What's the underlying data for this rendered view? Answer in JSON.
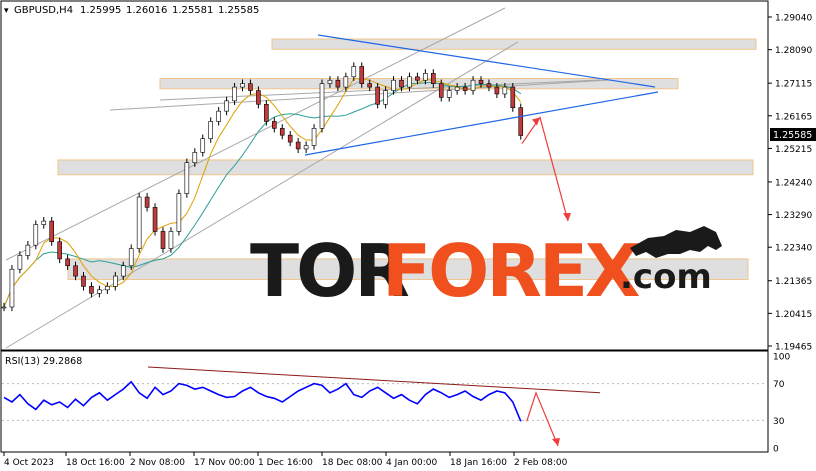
{
  "chart_data": {
    "type": "candlestick",
    "header": {
      "symbol": "GBPUSD,H4",
      "open": "1.25995",
      "high": "1.26016",
      "low": "1.25581",
      "close": "1.25585"
    },
    "price_axis": {
      "range": [
        1.19,
        1.299
      ],
      "ticks": [
        "1.29040",
        "1.28090",
        "1.27115",
        "1.26165",
        "1.25215",
        "1.24240",
        "1.23290",
        "1.22340",
        "1.21365",
        "1.20415",
        "1.19465"
      ],
      "current_price": "1.25585"
    },
    "time_axis": {
      "ticks": [
        "4 Oct 2023",
        "18 Oct 16:00",
        "2 Nov 08:00",
        "17 Nov 00:00",
        "1 Dec 16:00",
        "18 Dec 08:00",
        "4 Jan 00:00",
        "18 Jan 16:00",
        "2 Feb 08:00"
      ]
    },
    "price_series": {
      "x": [
        0,
        8,
        16,
        24,
        32,
        40,
        48,
        56,
        64,
        72,
        80,
        88,
        96,
        104,
        112,
        120,
        128,
        136,
        144,
        152,
        160,
        168,
        176,
        184,
        192,
        200,
        208,
        216,
        224,
        232,
        240,
        248,
        256,
        264,
        272,
        280,
        288,
        296,
        304,
        312,
        320,
        328,
        336,
        344,
        352,
        360,
        368,
        376,
        384,
        392,
        400,
        408,
        416,
        424,
        432,
        440,
        448,
        456,
        464,
        472,
        480,
        488,
        496,
        504,
        512,
        520
      ],
      "close": [
        1.206,
        1.217,
        1.221,
        1.224,
        1.23,
        1.231,
        1.225,
        1.22,
        1.218,
        1.215,
        1.212,
        1.21,
        1.211,
        1.212,
        1.215,
        1.218,
        1.223,
        1.238,
        1.235,
        1.228,
        1.223,
        1.228,
        1.239,
        1.248,
        1.251,
        1.255,
        1.26,
        1.263,
        1.266,
        1.27,
        1.271,
        1.269,
        1.265,
        1.26,
        1.258,
        1.256,
        1.254,
        1.252,
        1.253,
        1.258,
        1.271,
        1.272,
        1.27,
        1.273,
        1.276,
        1.271,
        1.27,
        1.265,
        1.269,
        1.272,
        1.27,
        1.273,
        1.272,
        1.274,
        1.271,
        1.267,
        1.269,
        1.27,
        1.269,
        1.272,
        1.271,
        1.27,
        1.268,
        1.27,
        1.264,
        1.2559
      ]
    },
    "horizontal_zones": [
      {
        "top": 1.284,
        "bottom": 1.281
      },
      {
        "top": 1.2725,
        "bottom": 1.2695
      },
      {
        "top": 1.2488,
        "bottom": 1.2445
      },
      {
        "top": 1.22,
        "bottom": 1.214
      }
    ],
    "forecast_arrows_price": [
      1.2559,
      1.26,
      1.231
    ],
    "rsi": {
      "label": "RSI(13) 29.2868",
      "levels": [
        "100",
        "70",
        "30",
        "0"
      ],
      "values": [
        55,
        50,
        58,
        48,
        42,
        52,
        47,
        50,
        44,
        53,
        46,
        55,
        60,
        52,
        58,
        64,
        72,
        60,
        54,
        66,
        58,
        62,
        70,
        68,
        64,
        66,
        62,
        58,
        55,
        56,
        62,
        66,
        60,
        56,
        54,
        50,
        56,
        62,
        66,
        70,
        68,
        60,
        64,
        70,
        58,
        55,
        62,
        66,
        60,
        54,
        58,
        52,
        48,
        58,
        64,
        60,
        55,
        58,
        62,
        56,
        52,
        58,
        62,
        60,
        50,
        29
      ]
    }
  },
  "watermark": {
    "text_a": "TOR",
    "text_b": "FOREX",
    "text_c": ".com",
    "color_a": "#1a1a1a",
    "color_b": "#f0501e"
  },
  "colors": {
    "zone_fill": "#dcdcdc",
    "zone_border": "#f0c080",
    "trend_blue": "#1e66e6",
    "channel_gray": "#a8a8a8",
    "forecast_red": "#ef3b3b",
    "rsi_line": "#0000ff",
    "rsi_trend": "#8b1a1a",
    "ma_slow": "#2aa198",
    "ma_fast": "#e0a000"
  }
}
